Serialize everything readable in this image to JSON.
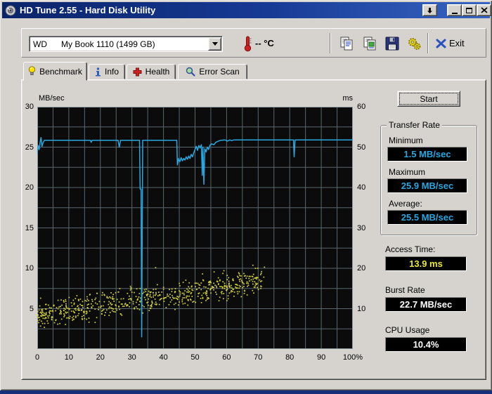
{
  "window": {
    "title": "HD Tune 2.55 - Hard Disk Utility"
  },
  "toolbar": {
    "drive_select_value": "WD      My Book 1110 (1499 GB)",
    "temperature": "-- °C",
    "exit_label": "Exit"
  },
  "tabs": [
    {
      "label": "Benchmark",
      "active": true
    },
    {
      "label": "Info",
      "active": false
    },
    {
      "label": "Health",
      "active": false
    },
    {
      "label": "Error Scan",
      "active": false
    }
  ],
  "benchmark": {
    "start_button": "Start",
    "transfer_rate": {
      "legend": "Transfer Rate",
      "minimum_label": "Minimum",
      "minimum_value": "1.5 MB/sec",
      "maximum_label": "Maximum",
      "maximum_value": "25.9 MB/sec",
      "average_label": "Average:",
      "average_value": "25.5 MB/sec"
    },
    "access_time_label": "Access Time:",
    "access_time_value": "13.9 ms",
    "burst_rate_label": "Burst Rate",
    "burst_rate_value": "22.7 MB/sec",
    "cpu_usage_label": "CPU Usage",
    "cpu_usage_value": "10.4%"
  },
  "chart_data": {
    "type": "line+scatter",
    "x_axis": {
      "range": [
        0,
        100
      ],
      "tick_values": [
        0,
        10,
        20,
        30,
        40,
        50,
        60,
        70,
        80,
        90,
        100
      ],
      "tick_labels": [
        "0",
        "10",
        "20",
        "30",
        "40",
        "50",
        "60",
        "70",
        "80",
        "90",
        "100%"
      ],
      "minor_grid_step": 5
    },
    "y_left": {
      "label": "MB/sec",
      "range": [
        0,
        30
      ],
      "tick_values": [
        30,
        25,
        20,
        15,
        10,
        5
      ],
      "tick_labels": [
        "30",
        "25",
        "20",
        "15",
        "10",
        "5"
      ],
      "grid_step": 2.5
    },
    "y_right": {
      "label": "ms",
      "range": [
        0,
        60
      ],
      "tick_values": [
        60,
        50,
        40,
        30,
        20,
        10
      ],
      "tick_labels": [
        "60",
        "50",
        "40",
        "30",
        "20",
        "10"
      ]
    },
    "grid": true,
    "series": [
      {
        "name": "Transfer Rate",
        "type": "line",
        "axis": "left",
        "color": "#28a7e0",
        "points": [
          [
            0,
            24.2
          ],
          [
            0.3,
            25.2
          ],
          [
            0.6,
            24.7
          ],
          [
            0.9,
            25.6
          ],
          [
            1.2,
            26.2
          ],
          [
            1.5,
            25.1
          ],
          [
            1.9,
            25.6
          ],
          [
            2.3,
            25.85
          ],
          [
            5,
            25.85
          ],
          [
            8,
            25.85
          ],
          [
            11,
            25.85
          ],
          [
            14,
            25.85
          ],
          [
            16.8,
            25.85
          ],
          [
            17.1,
            25.6
          ],
          [
            17.4,
            25.85
          ],
          [
            20,
            25.85
          ],
          [
            23,
            25.85
          ],
          [
            25.6,
            25.85
          ],
          [
            26,
            25.0
          ],
          [
            26.4,
            25.85
          ],
          [
            29,
            25.85
          ],
          [
            32.4,
            25.85
          ],
          [
            32.6,
            19.8
          ],
          [
            32.9,
            19.8
          ],
          [
            33.1,
            1.5
          ],
          [
            33.4,
            25.85
          ],
          [
            36,
            25.85
          ],
          [
            40,
            25.85
          ],
          [
            44.2,
            25.85
          ],
          [
            44.4,
            22.8
          ],
          [
            44.8,
            23.6
          ],
          [
            45.2,
            23.2
          ],
          [
            45.6,
            23.7
          ],
          [
            46,
            23.3
          ],
          [
            46.4,
            23.6
          ],
          [
            46.8,
            23.4
          ],
          [
            47.2,
            23.8
          ],
          [
            47.6,
            23.5
          ],
          [
            48,
            23.9
          ],
          [
            48.4,
            23.6
          ],
          [
            48.8,
            24.1
          ],
          [
            49.2,
            23.8
          ],
          [
            49.6,
            24.3
          ],
          [
            50,
            24.7
          ],
          [
            50.4,
            25.1
          ],
          [
            50.8,
            24.6
          ],
          [
            51.2,
            25.2
          ],
          [
            51.6,
            24.9
          ],
          [
            52,
            25.3
          ],
          [
            52.3,
            21.5
          ],
          [
            52.5,
            25.0
          ],
          [
            52.8,
            20.4
          ],
          [
            53.1,
            24.8
          ],
          [
            53.5,
            24.4
          ],
          [
            53.9,
            25.0
          ],
          [
            54.3,
            24.7
          ],
          [
            54.7,
            25.2
          ],
          [
            55.2,
            25.4
          ],
          [
            56,
            25.3
          ],
          [
            56.6,
            25.6
          ],
          [
            57.4,
            25.75
          ],
          [
            58.2,
            25.85
          ],
          [
            59.5,
            25.9
          ],
          [
            60.3,
            25.75
          ],
          [
            61,
            25.9
          ],
          [
            61.6,
            25.8
          ],
          [
            62.3,
            25.9
          ],
          [
            65,
            25.9
          ],
          [
            70,
            25.9
          ],
          [
            75,
            25.9
          ],
          [
            80,
            25.9
          ],
          [
            81.2,
            25.9
          ],
          [
            81.4,
            23.8
          ],
          [
            81.7,
            25.9
          ],
          [
            85,
            25.9
          ],
          [
            90,
            25.9
          ],
          [
            95,
            25.9
          ],
          [
            100,
            25.9
          ]
        ],
        "stats": {
          "minimum_mb_sec": 1.5,
          "maximum_mb_sec": 25.9,
          "average_mb_sec": 25.5
        }
      },
      {
        "name": "Access Time",
        "type": "scatter",
        "axis": "right",
        "color": "#d2d23c",
        "generated_noise": true,
        "count": 660,
        "seed": 20,
        "x_range": [
          0,
          72
        ],
        "ms_base": 8.5,
        "ms_slope": 0.115,
        "ms_jitter": 4.6,
        "clamp_ms": [
          5.2,
          23
        ],
        "average_ms": 13.9
      }
    ],
    "other_stats": {
      "burst_rate_mb_sec": 22.7,
      "cpu_usage_pct": 10.4
    }
  },
  "colors": {
    "accent_blue": "#28a7e0",
    "accent_yellow": "#e8e838",
    "plot_bg": "#0b0b0b",
    "grid": "#5a676d",
    "plot_border": "#8d9ba1",
    "titlebar_left": "#0a246a",
    "titlebar_right": "#3765c2",
    "window_bg": "#d6d3ce"
  }
}
